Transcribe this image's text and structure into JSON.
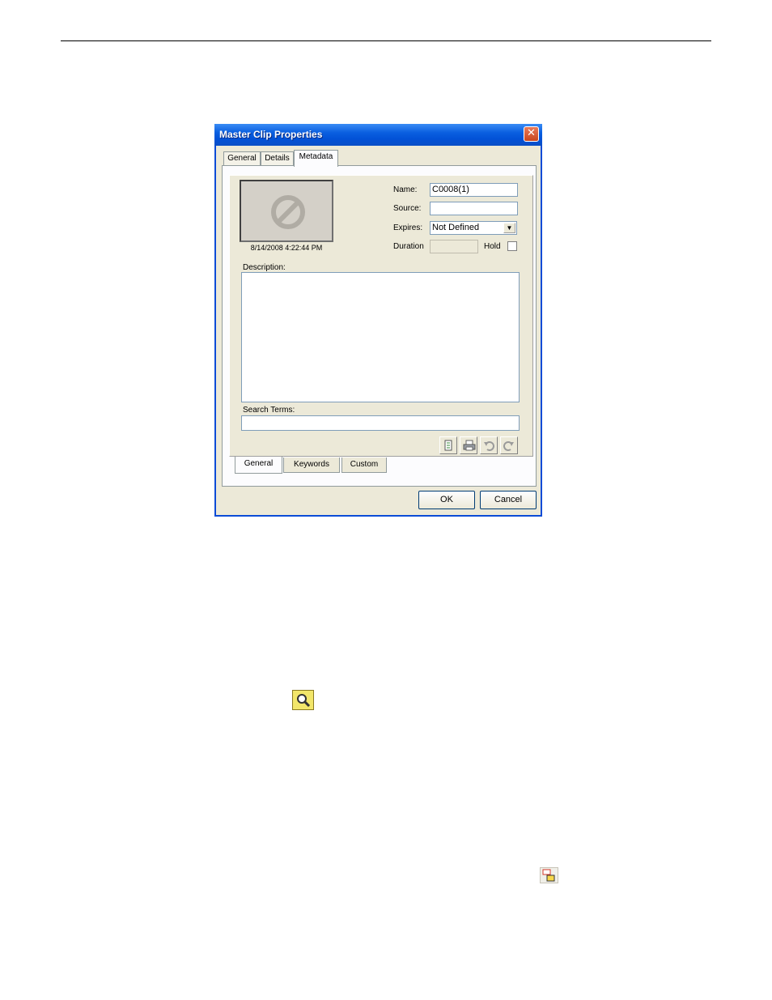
{
  "dialog": {
    "title": "Master Clip Properties",
    "close_glyph": "✕",
    "tabs": [
      "General",
      "Details",
      "Metadata"
    ],
    "active_tab": "Metadata",
    "thumbnail": {
      "icon": "no-video-icon",
      "date": "8/14/2008 4:22:44 PM"
    },
    "fields": {
      "name_label": "Name:",
      "name_value": "C0008(1)",
      "source_label": "Source:",
      "source_value": "",
      "expires_label": "Expires:",
      "expires_value": "Not Defined",
      "duration_label": "Duration",
      "duration_value": "",
      "hold_label": "Hold",
      "hold_checked": false
    },
    "description_label": "Description:",
    "description_value": "",
    "search_terms_label": "Search Terms:",
    "search_terms_value": "",
    "toolbar_icons": [
      "edit-icon",
      "print-icon",
      "undo-icon",
      "redo-icon"
    ],
    "bottom_tabs": [
      "General",
      "Keywords",
      "Custom"
    ],
    "active_bottom_tab": "General",
    "ok_label": "OK",
    "cancel_label": "Cancel"
  },
  "floating_icons": [
    "search-icon",
    "layout-icon"
  ],
  "colors": {
    "titlebar": "#0a5fe0",
    "dialog_bg": "#ece9d8",
    "search_icon_bg": "#f2e66a"
  }
}
